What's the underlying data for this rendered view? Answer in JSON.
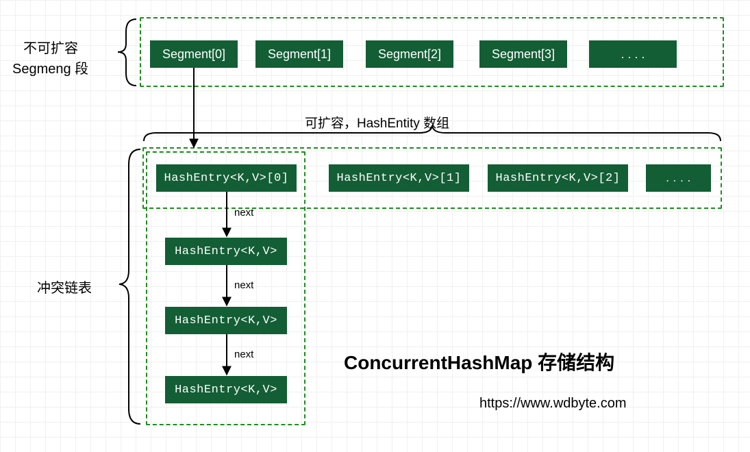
{
  "labels": {
    "nonExpandable1": "不可扩容",
    "nonExpandable2": "Segmeng 段",
    "expandable": "可扩容，HashEntity 数组",
    "conflictList": "冲突链表",
    "next": "next"
  },
  "segments": {
    "s0": "Segment[0]",
    "s1": "Segment[1]",
    "s2": "Segment[2]",
    "s3": "Segment[3]",
    "more": ". . . ."
  },
  "hashEntries": {
    "e0": "HashEntry<K,V>[0]",
    "e1": "HashEntry<K,V>[1]",
    "e2": "HashEntry<K,V>[2]",
    "more": ". . . .",
    "node": "HashEntry<K,V>"
  },
  "title": "ConcurrentHashMap 存储结构",
  "url": "https://www.wdbyte.com"
}
